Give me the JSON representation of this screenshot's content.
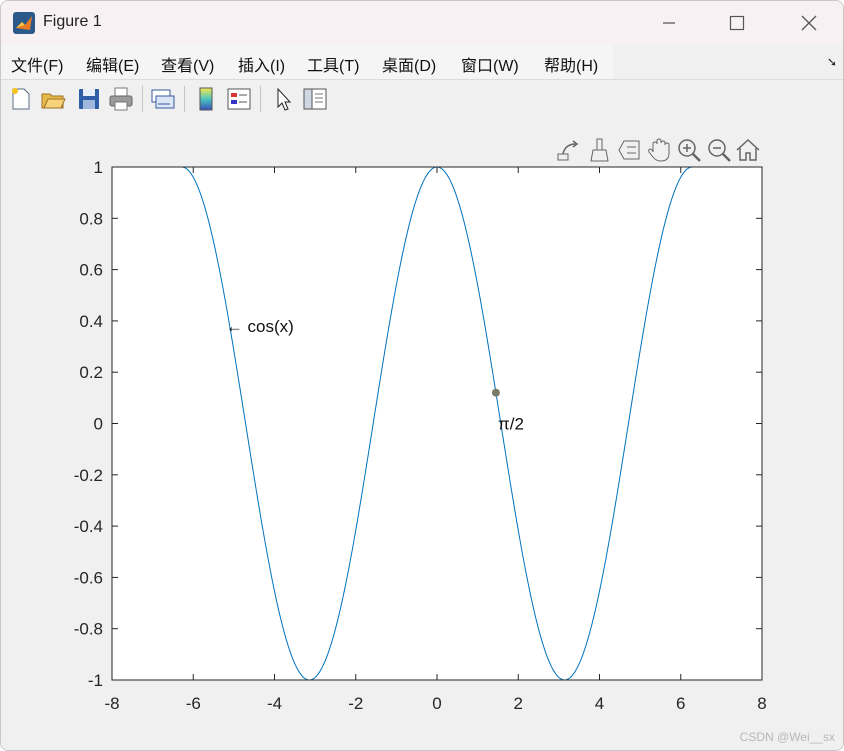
{
  "window": {
    "title": "Figure 1"
  },
  "menu": [
    "文件(F)",
    "编辑(E)",
    "查看(V)",
    "插入(I)",
    "工具(T)",
    "桌面(D)",
    "窗口(W)",
    "帮助(H)"
  ],
  "toolbar_icons": [
    "new-figure-icon",
    "open-file-icon",
    "save-icon",
    "print-icon",
    "link-plot-icon",
    "colorbar-icon",
    "legend-icon",
    "edit-plot-icon",
    "property-inspector-icon"
  ],
  "axes_toolbar_icons": [
    "export-icon",
    "brush-icon",
    "data-tips-icon",
    "pan-icon",
    "zoom-in-icon",
    "zoom-out-icon",
    "home-icon"
  ],
  "watermark": "CSDN @Wei__sx",
  "chart_data": {
    "type": "line",
    "title": "",
    "xlabel": "",
    "ylabel": "",
    "xlim": [
      -8,
      8
    ],
    "ylim": [
      -1,
      1
    ],
    "x_ticks": [
      "-8",
      "-6",
      "-4",
      "-2",
      "0",
      "2",
      "4",
      "6",
      "8"
    ],
    "y_ticks": [
      "-1",
      "-0.8",
      "-0.6",
      "-0.4",
      "-0.2",
      "0",
      "0.2",
      "0.4",
      "0.6",
      "0.8",
      "1"
    ],
    "x_range": [
      -6.2832,
      6.2832
    ],
    "series": [
      {
        "function": "cos(x)",
        "color": "#0072bd",
        "x": [
          -6.2832,
          -5.4978,
          -4.7124,
          -3.927,
          -3.1416,
          -2.3562,
          -1.5708,
          -0.7854,
          0,
          0.7854,
          1.5708,
          2.3562,
          3.1416,
          3.927,
          4.7124,
          5.4978,
          6.2832
        ],
        "y": [
          1,
          0.7071,
          0,
          -0.7071,
          -1,
          -0.7071,
          0,
          0.7071,
          1,
          0.7071,
          0,
          -0.7071,
          -1,
          -0.7071,
          0,
          0.7071,
          1
        ]
      }
    ],
    "annotations": [
      {
        "text": "← cos(x)",
        "x": -5.1,
        "y": 0.38
      },
      {
        "text": "π/2",
        "x": 1.6,
        "y": 0
      }
    ],
    "marker": {
      "x": 1.45,
      "y": 0.12,
      "color": "#7a7a6a"
    }
  }
}
